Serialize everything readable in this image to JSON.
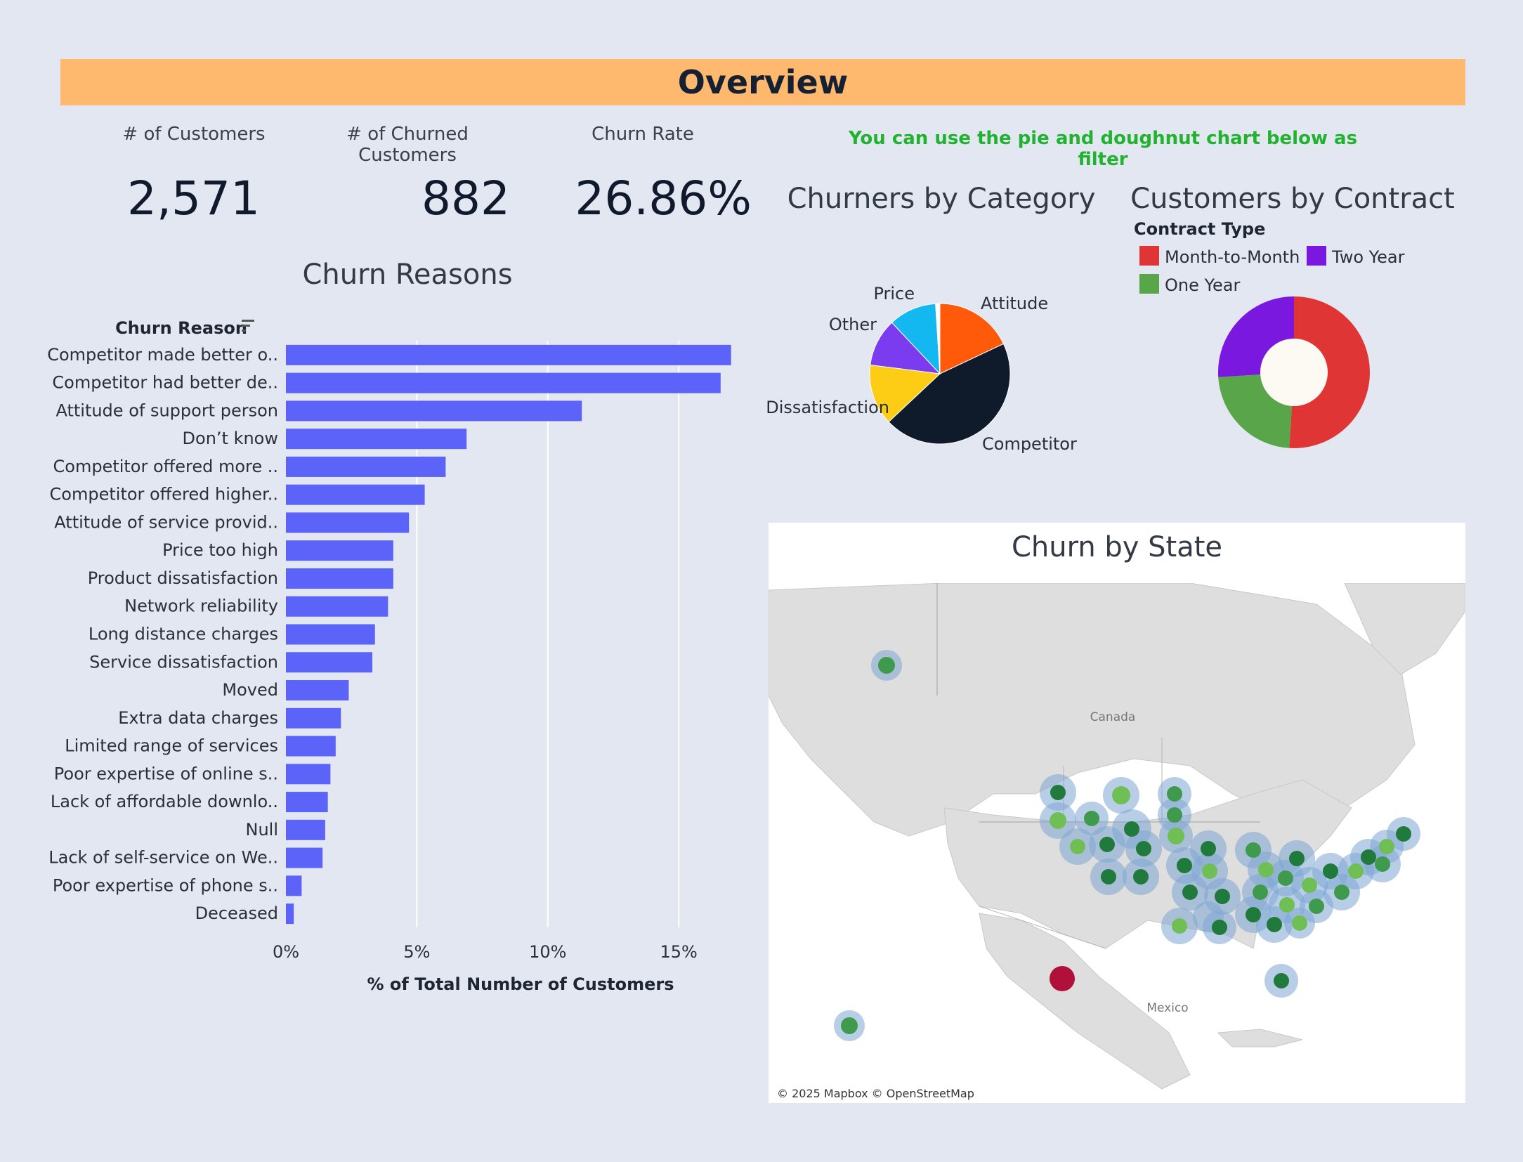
{
  "header": {
    "title": "Overview"
  },
  "kpis": [
    {
      "label": "# of Customers",
      "value": "2,571"
    },
    {
      "label": "# of Churned Customers",
      "value": "882"
    },
    {
      "label": "Churn Rate",
      "value": "26.86%"
    }
  ],
  "filter_hint": "You can use the pie and doughnut chart below as filter",
  "map": {
    "title": "Churn by State",
    "attribution": "© 2025 Mapbox © OpenStreetMap",
    "labels": {
      "canada": "Canada",
      "mexico": "Mexico"
    },
    "colors": {
      "land": "#dedede",
      "halo": "#7ea6d3",
      "dot_dark": "#1f7a3c",
      "dot_mid": "#3f9a4d",
      "dot_light": "#6fbf55",
      "highlight": "#b0103a"
    }
  },
  "colors": {
    "bar": "#5b63f8",
    "attitude": "#ff5a0a",
    "competitor": "#0f1a2b",
    "dissatisfaction": "#fccd14",
    "other": "#7b3cf0",
    "price": "#14b8f0",
    "month_to_month": "#e03535",
    "one_year": "#58a54a",
    "two_year": "#7a18e0"
  },
  "chart_data": [
    {
      "type": "bar",
      "orientation": "horizontal",
      "title": "Churn Reasons",
      "ylabel": "Churn Reason",
      "xlabel": "% of Total Number of Customers",
      "xlim": [
        0,
        18
      ],
      "xticks": [
        "0%",
        "5%",
        "10%",
        "15%"
      ],
      "grid": true,
      "categories": [
        "Competitor made better o..",
        "Competitor had better de..",
        "Attitude of support person",
        "Don’t know",
        "Competitor offered more ..",
        "Competitor offered higher..",
        "Attitude of service provid..",
        "Price too high",
        "Product dissatisfaction",
        "Network reliability",
        "Long distance charges",
        "Service dissatisfaction",
        "Moved",
        "Extra data charges",
        "Limited range of services",
        "Poor expertise of online s..",
        "Lack of affordable downlo..",
        "Null",
        "Lack of self-service on We..",
        "Poor expertise of phone s..",
        "Deceased"
      ],
      "values": [
        17.0,
        16.6,
        11.3,
        6.9,
        6.1,
        5.3,
        4.7,
        4.1,
        4.1,
        3.9,
        3.4,
        3.3,
        2.4,
        2.1,
        1.9,
        1.7,
        1.6,
        1.5,
        1.4,
        0.6,
        0.3
      ]
    },
    {
      "type": "pie",
      "title": "Churners by Category",
      "slices": [
        {
          "name": "Attitude",
          "value": 18
        },
        {
          "name": "Competitor",
          "value": 45
        },
        {
          "name": "Dissatisfaction",
          "value": 14
        },
        {
          "name": "Other",
          "value": 11
        },
        {
          "name": "Price",
          "value": 11
        },
        {
          "name": "",
          "value": 1
        }
      ]
    },
    {
      "type": "pie",
      "variant": "doughnut",
      "title": "Customers by Contract",
      "legend_title": "Contract Type",
      "legend_position": "top",
      "legend": [
        "Month-to-Month",
        "Two Year",
        "One Year"
      ],
      "slices": [
        {
          "name": "Month-to-Month",
          "value": 51
        },
        {
          "name": "One Year",
          "value": 23
        },
        {
          "name": "Two Year",
          "value": 26
        }
      ]
    }
  ]
}
